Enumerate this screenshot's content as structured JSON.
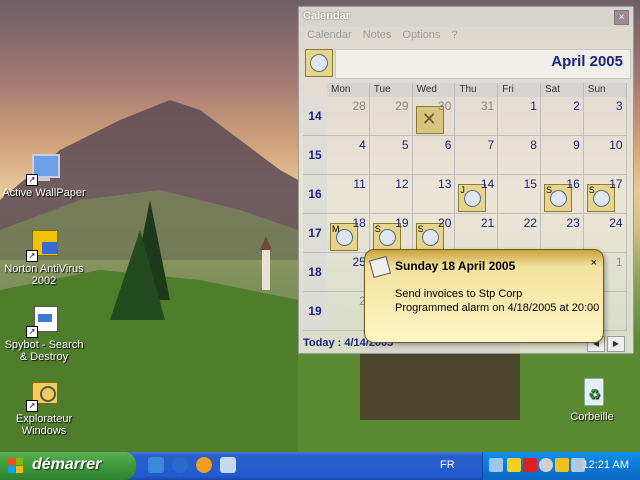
{
  "desktop": {
    "icons": [
      {
        "label": "Active WallPaper",
        "icon": "monitor-icon"
      },
      {
        "label": "Norton AntiVirus 2002",
        "icon": "norton-icon"
      },
      {
        "label": "Spybot - Search & Destroy",
        "icon": "spybot-icon"
      },
      {
        "label": "Explorateur Windows",
        "icon": "explorer-icon"
      },
      {
        "label": "Corbeille",
        "icon": "recycle-bin-icon"
      }
    ]
  },
  "calendar": {
    "title": "Calendar",
    "close": "×",
    "menu": [
      "Calendar",
      "Notes",
      "Options",
      "?"
    ],
    "month": "April 2005",
    "weekdays": [
      "Mon",
      "Tue",
      "Wed",
      "Thu",
      "Fri",
      "Sat",
      "Sun"
    ],
    "weeks": [
      {
        "wk": "14",
        "days": [
          {
            "n": "28",
            "other": true
          },
          {
            "n": "29",
            "other": true
          },
          {
            "n": "30",
            "other": true,
            "note": "crossed"
          },
          {
            "n": "31",
            "other": true
          },
          {
            "n": "1"
          },
          {
            "n": "2"
          },
          {
            "n": "3"
          }
        ]
      },
      {
        "wk": "15",
        "days": [
          {
            "n": "4"
          },
          {
            "n": "5"
          },
          {
            "n": "6"
          },
          {
            "n": "7"
          },
          {
            "n": "8"
          },
          {
            "n": "9"
          },
          {
            "n": "10"
          }
        ]
      },
      {
        "wk": "16",
        "days": [
          {
            "n": "11"
          },
          {
            "n": "12"
          },
          {
            "n": "13"
          },
          {
            "n": "14",
            "note": "J"
          },
          {
            "n": "15"
          },
          {
            "n": "16",
            "note": "S"
          },
          {
            "n": "17",
            "note": "S"
          }
        ]
      },
      {
        "wk": "17",
        "days": [
          {
            "n": "18",
            "note": "M"
          },
          {
            "n": "19",
            "note": "S"
          },
          {
            "n": "20",
            "note": "S"
          },
          {
            "n": "21"
          },
          {
            "n": "22"
          },
          {
            "n": "23"
          },
          {
            "n": "24"
          }
        ]
      },
      {
        "wk": "18",
        "days": [
          {
            "n": "25"
          },
          {
            "n": ""
          },
          {
            "n": ""
          },
          {
            "n": ""
          },
          {
            "n": ""
          },
          {
            "n": ""
          },
          {
            "n": "1",
            "other": true
          }
        ]
      },
      {
        "wk": "19",
        "days": [
          {
            "n": "2",
            "other": true
          },
          {
            "n": ""
          },
          {
            "n": ""
          },
          {
            "n": ""
          },
          {
            "n": ""
          },
          {
            "n": ""
          },
          {
            "n": ""
          }
        ]
      }
    ],
    "today": "Today : 4/14/2005",
    "nav_prev": "◀",
    "nav_next": "▶"
  },
  "popup": {
    "title": "Sunday 18 April 2005",
    "close": "×",
    "line1": "Send invoices to Stp Corp",
    "line2": "Programmed alarm on 4/18/2005 at 20:00"
  },
  "taskbar": {
    "start": "démarrer",
    "quicklaunch": [
      "outlook-express-icon",
      "internet-explorer-icon",
      "media-player-icon",
      "show-desktop-icon"
    ],
    "language": "FR",
    "tray_icons": [
      "network-icon",
      "shield-icon",
      "zonealarm-icon",
      "speaker-icon",
      "antivirus-icon",
      "printer-icon"
    ],
    "clock": "12:21 AM"
  }
}
